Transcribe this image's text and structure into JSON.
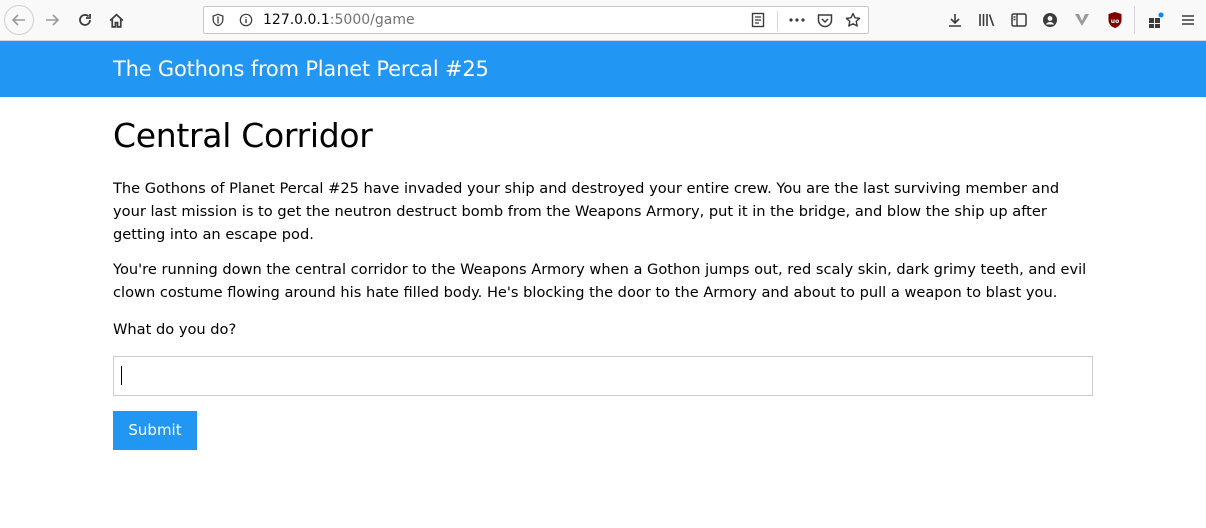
{
  "browser": {
    "url_host": "127.0.0.1",
    "url_path": ":5000/game",
    "icons": [
      "back-icon",
      "forward-icon",
      "reload-icon",
      "home-icon",
      "tracking-protection-icon",
      "info-icon",
      "reader-view-icon",
      "more-icon",
      "pocket-icon",
      "bookmark-star-icon",
      "downloads-icon",
      "library-icon",
      "sidebar-icon",
      "account-icon",
      "vivaldi-icon",
      "ublock-icon",
      "extensions-icon",
      "menu-icon"
    ]
  },
  "header": {
    "title": "The Gothons from Planet Percal #25"
  },
  "room": {
    "title": "Central Corridor",
    "paragraphs": [
      "The Gothons of Planet Percal #25 have invaded your ship and destroyed your entire crew. You are the last surviving member and your last mission is to get the neutron destruct bomb from the Weapons Armory, put it in the bridge, and blow the ship up after getting into an escape pod.",
      "You're running down the central corridor to the Weapons Armory when a Gothon jumps out, red scaly skin, dark grimy teeth, and evil clown costume flowing around his hate filled body. He's blocking the door to the Armory and about to pull a weapon to blast you."
    ],
    "prompt": "What do you do?"
  },
  "form": {
    "answer_value": "",
    "submit_label": "Submit"
  },
  "colors": {
    "brand": "#2196f3",
    "ublock": "#800000"
  }
}
